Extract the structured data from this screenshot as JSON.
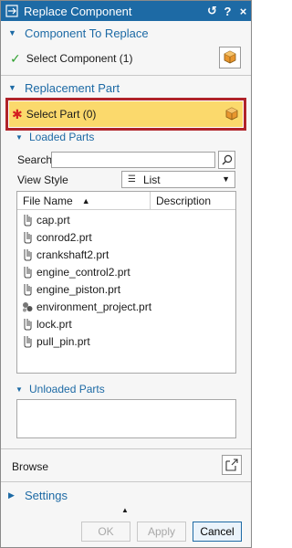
{
  "window": {
    "title": "Replace Component",
    "reset_glyph": "↺",
    "help_glyph": "?",
    "close_glyph": "×"
  },
  "component_to_replace": {
    "header": "Component To Replace",
    "select_label": "Select Component (1)"
  },
  "replacement_part": {
    "header": "Replacement Part",
    "select_label": "Select Part (0)"
  },
  "loaded_parts": {
    "header": "Loaded Parts",
    "search_label": "Search",
    "search_value": "",
    "view_style_label": "View Style",
    "view_style_value": "List",
    "columns": [
      "File Name",
      "Description"
    ],
    "files": [
      {
        "name": "cap.prt",
        "icon": "part-icon"
      },
      {
        "name": "conrod2.prt",
        "icon": "part-icon"
      },
      {
        "name": "crankshaft2.prt",
        "icon": "part-icon"
      },
      {
        "name": "engine_control2.prt",
        "icon": "part-icon"
      },
      {
        "name": "engine_piston.prt",
        "icon": "part-icon"
      },
      {
        "name": "environment_project.prt",
        "icon": "assembly-icon"
      },
      {
        "name": "lock.prt",
        "icon": "part-icon"
      },
      {
        "name": "pull_pin.prt",
        "icon": "part-icon"
      }
    ]
  },
  "unloaded_parts": {
    "header": "Unloaded Parts"
  },
  "browse": {
    "label": "Browse"
  },
  "settings": {
    "header": "Settings"
  },
  "buttons": {
    "ok": "OK",
    "apply": "Apply",
    "cancel": "Cancel"
  },
  "colors": {
    "accent": "#1d6aa5",
    "highlight": "#fbd96c",
    "required_border": "#b0232a",
    "check": "#2ea02e"
  }
}
